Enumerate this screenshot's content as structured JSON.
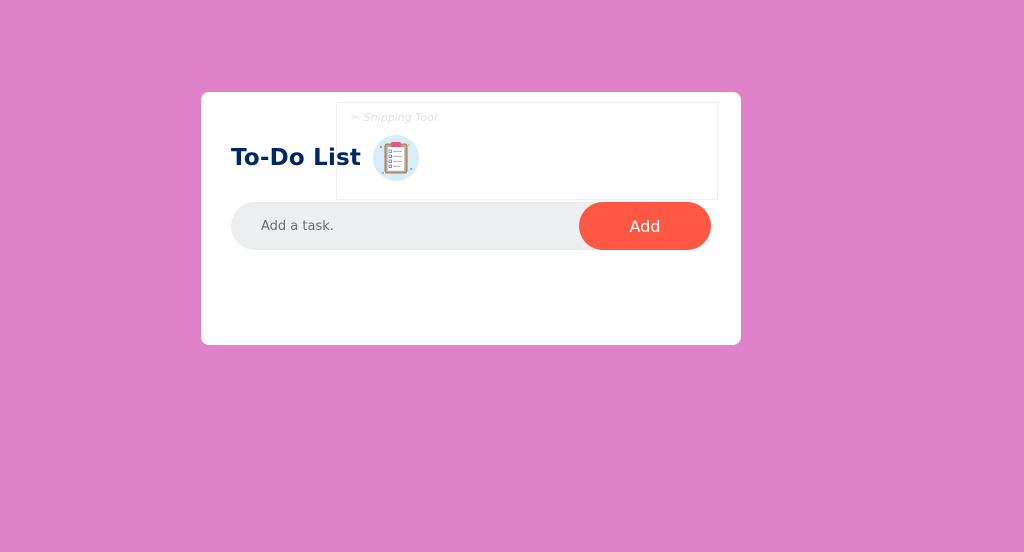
{
  "page": {
    "background_color": "#e082ca"
  },
  "overlay": {
    "label": "✂ Snipping Tool"
  },
  "todo": {
    "title": "To-Do List",
    "title_icon": "clipboard-checklist-icon",
    "input_placeholder": "Add a task.",
    "input_value": "",
    "add_label": "Add",
    "accent_color": "#ff5945",
    "title_color": "#002765"
  }
}
